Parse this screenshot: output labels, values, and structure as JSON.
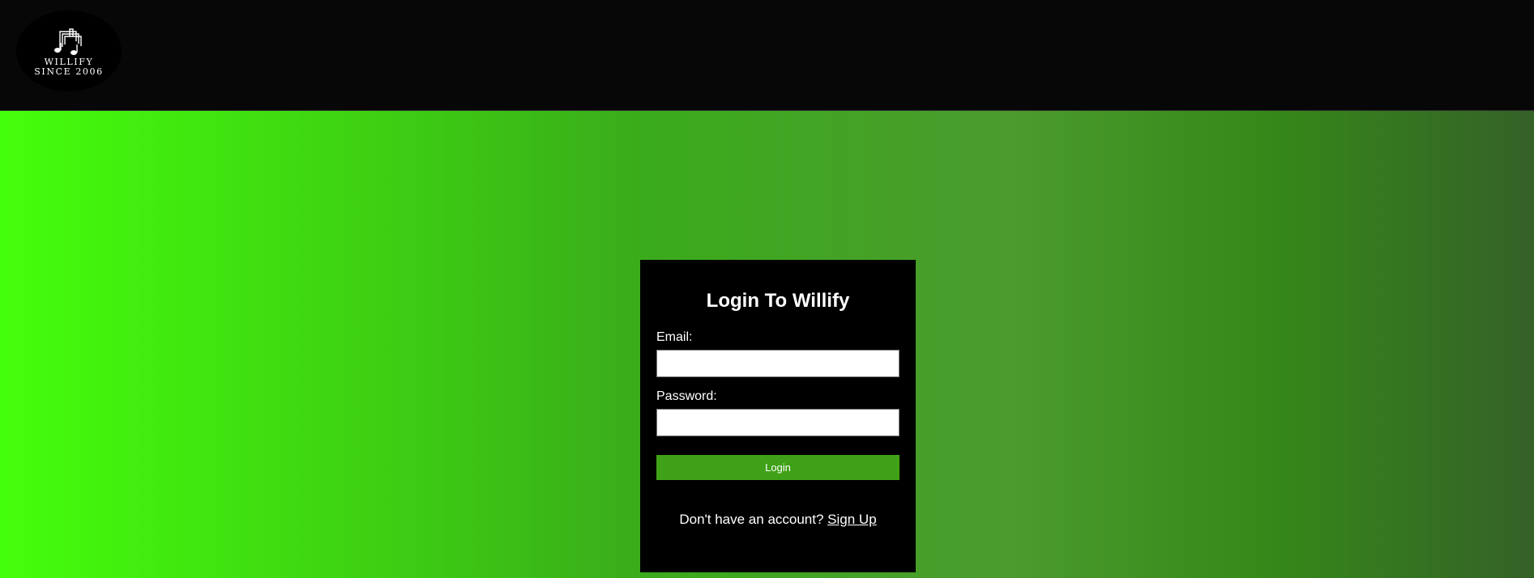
{
  "header": {
    "logo": {
      "icon": "music-notes-icon",
      "line1": "WILLIFY",
      "line2": "SINCE 2006"
    }
  },
  "login": {
    "title": "Login To Willify",
    "email_label": "Email:",
    "email_value": "",
    "password_label": "Password:",
    "password_value": "",
    "button_label": "Login",
    "signup_prompt": "Don't have an account?",
    "signup_link": "Sign Up"
  },
  "colors": {
    "header_bg": "#070707",
    "card_bg": "#000000",
    "button_bg": "#3fa117",
    "gradient_start": "#44ff0b",
    "gradient_end": "#356128"
  }
}
